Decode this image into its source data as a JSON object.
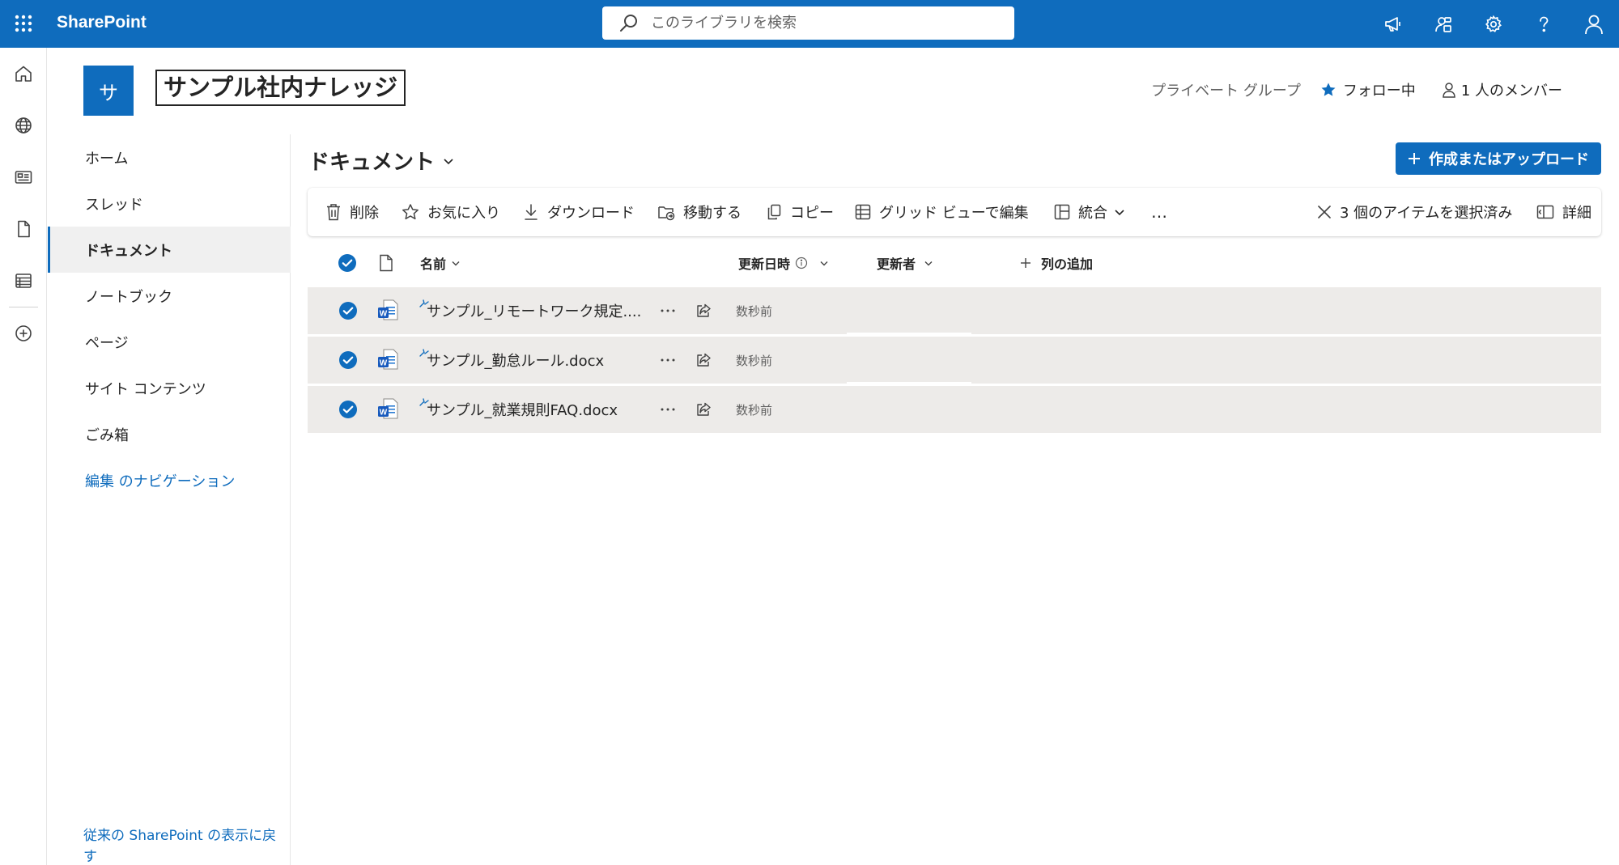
{
  "app": {
    "brand": "SharePoint",
    "accent": "#0f6cbd"
  },
  "search": {
    "placeholder": "このライブラリを検索"
  },
  "site": {
    "logo_letter": "サ",
    "title": "サンプル社内ナレッジ",
    "privacy": "プライベート グループ",
    "follow_label": "フォロー中",
    "members_label": "1 人のメンバー"
  },
  "nav": {
    "items": [
      {
        "label": "ホーム"
      },
      {
        "label": "スレッド"
      },
      {
        "label": "ドキュメント"
      },
      {
        "label": "ノートブック"
      },
      {
        "label": "ページ"
      },
      {
        "label": "サイト コンテンツ"
      },
      {
        "label": "ごみ箱"
      },
      {
        "label": "編集 のナビゲーション"
      }
    ],
    "classic_link": "従来の SharePoint の表示に戻す"
  },
  "library": {
    "title": "ドキュメント",
    "create_label": "作成またはアップロード"
  },
  "commands": {
    "delete": "削除",
    "favorite": "お気に入り",
    "download": "ダウンロード",
    "move": "移動する",
    "copy": "コピー",
    "grid_edit": "グリッド ビューで編集",
    "integrate": "統合",
    "more": "…",
    "selected": "3 個のアイテムを選択済み",
    "details": "詳細"
  },
  "columns": {
    "name": "名前",
    "modified": "更新日時",
    "modified_by": "更新者",
    "add_column": "列の追加"
  },
  "files": [
    {
      "name": "サンプル_リモートワーク規定....",
      "modified": "数秒前"
    },
    {
      "name": "サンプル_勤怠ルール.docx",
      "modified": "数秒前"
    },
    {
      "name": "サンプル_就業規則FAQ.docx",
      "modified": "数秒前"
    }
  ]
}
